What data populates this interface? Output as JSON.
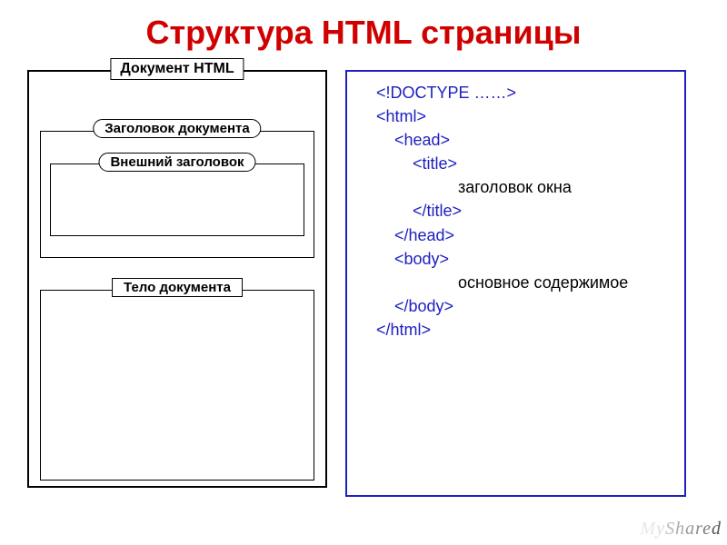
{
  "title": "Структура HTML страницы",
  "diagram": {
    "doc_label": "Документ HTML",
    "header_label": "Заголовок документа",
    "title_label": "Внешний заголовок",
    "body_label": "Тело документа"
  },
  "code": {
    "lines": [
      {
        "indent": "l1",
        "text": "<!DOCTYPE ……>",
        "cls": ""
      },
      {
        "indent": "l1",
        "text": "<html>",
        "cls": ""
      },
      {
        "indent": "l2",
        "text": "<head>",
        "cls": ""
      },
      {
        "indent": "l3",
        "text": "<title>",
        "cls": ""
      },
      {
        "indent": "l4",
        "text": "заголовок окна",
        "cls": "black"
      },
      {
        "indent": "l3",
        "text": "</title>",
        "cls": ""
      },
      {
        "indent": "l2",
        "text": "</head>",
        "cls": ""
      },
      {
        "indent": "l2",
        "text": "<body>",
        "cls": ""
      },
      {
        "indent": "l2",
        "text": " ",
        "cls": ""
      },
      {
        "indent": "l4",
        "text": "основное содержимое",
        "cls": "black"
      },
      {
        "indent": "l2",
        "text": " ",
        "cls": ""
      },
      {
        "indent": "l2",
        "text": " ",
        "cls": ""
      },
      {
        "indent": "l2",
        "text": "</body>",
        "cls": ""
      },
      {
        "indent": "l1",
        "text": "</html>",
        "cls": ""
      }
    ]
  },
  "watermark": "MyShared"
}
